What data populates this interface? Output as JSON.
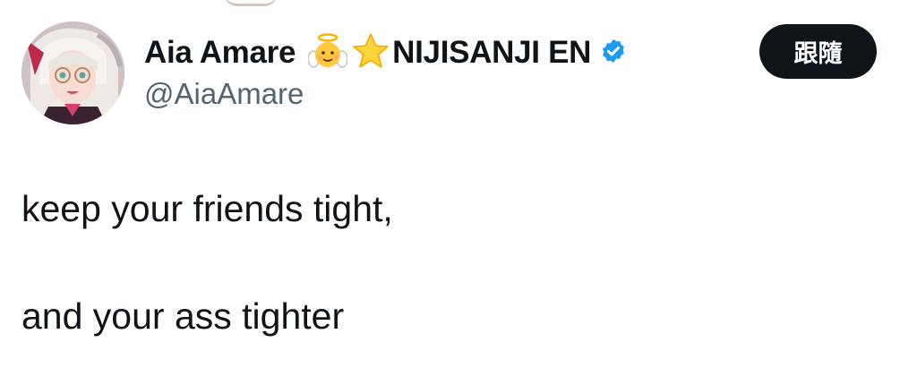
{
  "tweet": {
    "author": {
      "display_name": "Aia Amare",
      "name_emojis": [
        "baby-angel-emoji",
        "star-emoji"
      ],
      "affiliation": "NIJISANJI EN",
      "verified": true,
      "handle": "@AiaAmare",
      "avatar": "avatar-illustration"
    },
    "follow_label": "跟隨",
    "text_lines": [
      "keep your friends tight,",
      "and your ass tighter"
    ]
  },
  "colors": {
    "text": "#0f1419",
    "handle": "#536471",
    "verified_badge": "#1d9bf0",
    "follow_bg": "#0f1419",
    "follow_text": "#ffffff"
  }
}
